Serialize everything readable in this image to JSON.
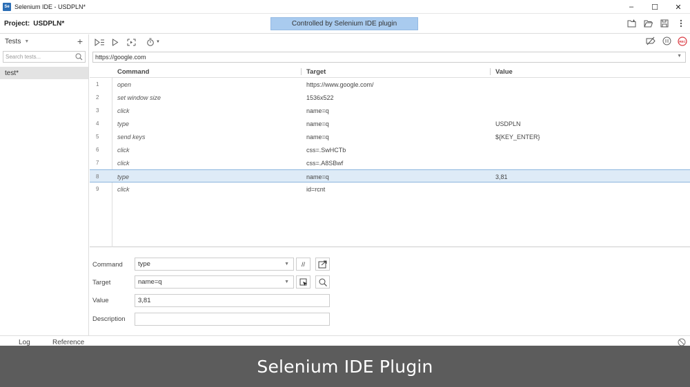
{
  "window": {
    "title": "Selenium IDE - USDPLN*",
    "app_icon_text": "Se",
    "minimize": "–",
    "maximize": "☐",
    "close": "✕"
  },
  "project": {
    "label": "Project:",
    "name": "USDPLN*",
    "banner": "Controlled by Selenium IDE plugin"
  },
  "sidebar": {
    "heading": "Tests",
    "add_label": "+",
    "search_placeholder": "Search tests...",
    "tests": [
      {
        "label": "test*"
      }
    ]
  },
  "url": {
    "value": "https://google.com"
  },
  "table": {
    "headers": {
      "command": "Command",
      "target": "Target",
      "value": "Value"
    },
    "rows": [
      {
        "num": "1",
        "command": "open",
        "target": "https://www.google.com/",
        "value": ""
      },
      {
        "num": "2",
        "command": "set window size",
        "target": "1536x522",
        "value": ""
      },
      {
        "num": "3",
        "command": "click",
        "target": "name=q",
        "value": ""
      },
      {
        "num": "4",
        "command": "type",
        "target": "name=q",
        "value": "USDPLN"
      },
      {
        "num": "5",
        "command": "send keys",
        "target": "name=q",
        "value": "${KEY_ENTER}"
      },
      {
        "num": "6",
        "command": "click",
        "target": "css=.SwHCTb",
        "value": ""
      },
      {
        "num": "7",
        "command": "click",
        "target": "css=.A8SBwf",
        "value": ""
      },
      {
        "num": "8",
        "command": "type",
        "target": "name=q",
        "value": "3,81"
      },
      {
        "num": "9",
        "command": "click",
        "target": "id=rcnt",
        "value": ""
      }
    ],
    "selected_row": 8
  },
  "editor": {
    "command_label": "Command",
    "command_value": "type",
    "comment_button": "//",
    "target_label": "Target",
    "target_value": "name=q",
    "value_label": "Value",
    "value_value": "3,81",
    "description_label": "Description",
    "description_value": ""
  },
  "bottom_tabs": {
    "log": "Log",
    "reference": "Reference"
  },
  "caption": "Selenium IDE Plugin",
  "colors": {
    "accent": "#2a6db5",
    "banner": "#a9cbef",
    "record": "#d9363e",
    "selected_row": "#deebf7",
    "caption_bg": "#5c5c5c"
  }
}
